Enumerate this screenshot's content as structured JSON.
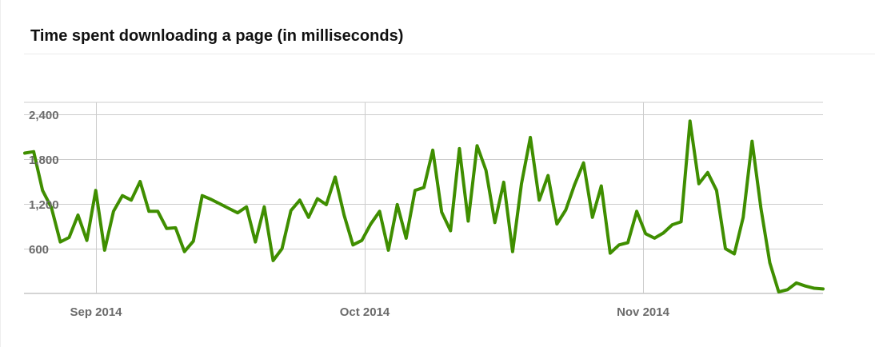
{
  "title": "Time spent downloading a page (in milliseconds)",
  "colors": {
    "line": "#3f8e00",
    "grid": "#cccccc",
    "axis_text": "#6b6b6b"
  },
  "chart_data": {
    "type": "line",
    "title": "Time spent downloading a page (in milliseconds)",
    "xlabel": "",
    "ylabel": "",
    "x_tick_labels": [
      "Sep 2014",
      "Oct 2014",
      "Nov 2014"
    ],
    "y_ticks": [
      600,
      1200,
      1800,
      2400
    ],
    "y_tick_labels": [
      "600",
      "1,200",
      "1,800",
      "2,400"
    ],
    "ylim": [
      0,
      2400
    ],
    "grid": true,
    "legend": "none",
    "series": [
      {
        "values": [
          1880,
          1900,
          1380,
          1150,
          690,
          750,
          1050,
          710,
          1380,
          580,
          1100,
          1310,
          1250,
          1500,
          1100,
          1100,
          870,
          880,
          560,
          700,
          1310,
          1260,
          1200,
          1140,
          1080,
          1160,
          690,
          1160,
          440,
          600,
          1110,
          1250,
          1020,
          1270,
          1190,
          1560,
          1050,
          650,
          710,
          930,
          1100,
          580,
          1190,
          740,
          1380,
          1420,
          1920,
          1090,
          840,
          1940,
          970,
          1980,
          1650,
          950,
          1490,
          560,
          1470,
          2090,
          1250,
          1580,
          930,
          1120,
          1460,
          1750,
          1020,
          1440,
          540,
          650,
          680,
          1100,
          800,
          740,
          810,
          920,
          960,
          2310,
          1470,
          1620,
          1380,
          600,
          530,
          1020,
          2040,
          1140,
          410,
          20,
          50,
          140,
          100,
          70,
          60
        ]
      }
    ]
  }
}
